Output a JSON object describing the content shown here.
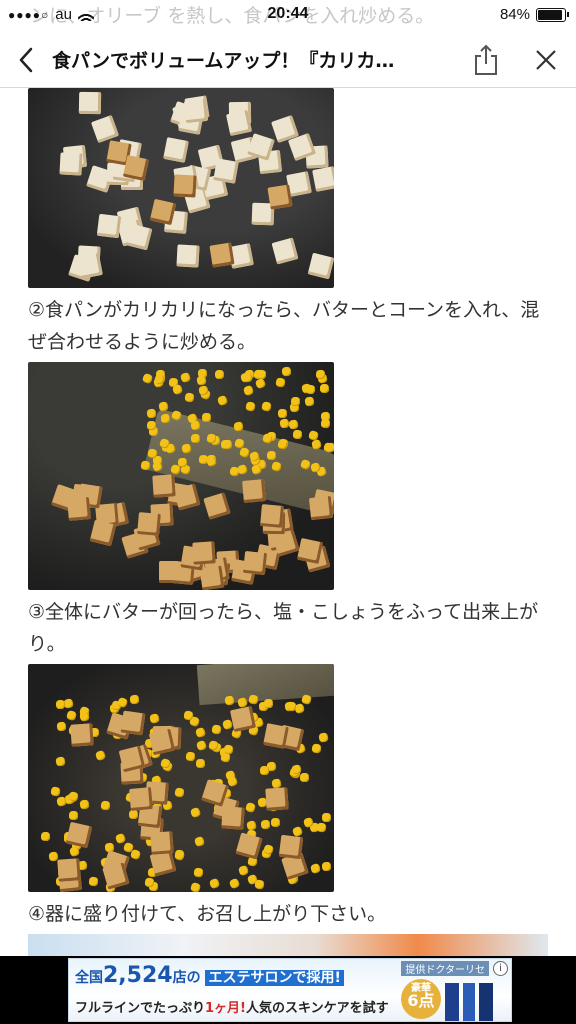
{
  "status_bar": {
    "carrier": "au",
    "time": "20:44",
    "battery_text": "84%",
    "battery_level": 0.84,
    "signal_dots": "●●●●○"
  },
  "ghost_text": "ンに、オリーブ   を熱し、食パンを入れ炒める。",
  "nav": {
    "title": "食パンでボリュームアップ！『カリカ…",
    "back_icon": "chevron-left-icon",
    "share_icon": "share-icon",
    "close_icon": "close-icon"
  },
  "steps": [
    {
      "text": "②食パンがカリカリになったら、バターとコーンを入れ、混ぜ合わせるように炒める。"
    },
    {
      "text": "③全体にバターが回ったら、塩・こしょうをふって出来上がり。"
    },
    {
      "text": "④器に盛り付けて、お召し上がり下さい。"
    }
  ],
  "ad": {
    "line1_prefix": "全国",
    "line1_number": "2,524",
    "line1_suffix": "店の",
    "line1_highlight": "エステサロンで採用!",
    "line2_a": "フルラインでたっぷり",
    "line2_red": "1ヶ月!",
    "line2_b": "人気のスキンケアを試す",
    "sponsor": "提供ドクターリセ",
    "badge_top": "豪華",
    "badge_num": "6点",
    "info": "i"
  },
  "colors": {
    "ad_blue": "#1a56b0",
    "ad_red": "#d42a2a"
  }
}
